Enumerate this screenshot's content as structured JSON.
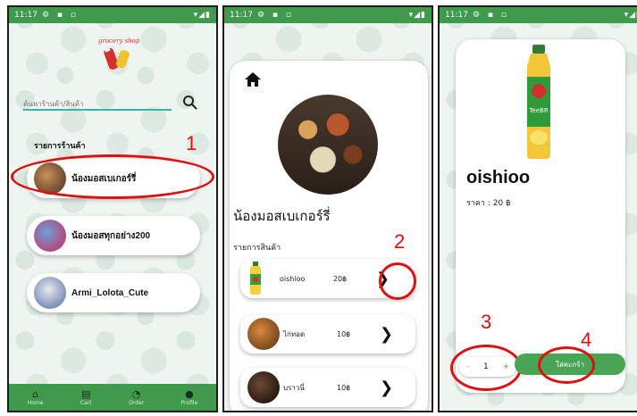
{
  "screen1": {
    "status_time": "11:17",
    "status_icons": "▾◢▮",
    "search_placeholder": "ค้นหาร้านค้า/สินค้า",
    "section_title": "รายการร้านค้า",
    "shops": [
      {
        "name": "น้องมอสเบเกอร์รี่"
      },
      {
        "name": "น้องมอสทุกอย่าง200"
      },
      {
        "name": "Armi_Lolota_Cute"
      }
    ],
    "nav": [
      {
        "label": "Home",
        "icon": "home-icon"
      },
      {
        "label": "Cart",
        "icon": "cart-icon"
      },
      {
        "label": "Order",
        "icon": "clock-icon"
      },
      {
        "label": "Profile",
        "icon": "user-icon"
      }
    ],
    "annotation": "1"
  },
  "screen2": {
    "status_time": "11:17",
    "status_icons": "▾◢▮",
    "shop_title": "น้องมอสเบเกอร์รี่",
    "section_title": "รายการสินค้า",
    "products": [
      {
        "name": "oishioo",
        "price": "20฿"
      },
      {
        "name": "ไก่ทอด",
        "price": "10฿"
      },
      {
        "name": "บราวนี่",
        "price": "10฿"
      }
    ],
    "annotation": "2"
  },
  "screen3": {
    "status_time": "11:17",
    "status_icons": "▾◢▮",
    "product_name": "oishioo",
    "price_text": "ราคา : 20 ฿",
    "quantity": "1",
    "minus": "-",
    "plus": "+",
    "add_to_cart": "ใส่ตะกร้า",
    "annotation_qty": "3",
    "annotation_cart": "4"
  },
  "colors": {
    "primary_green": "#3f9a4c",
    "annotation_red": "#e01010"
  }
}
